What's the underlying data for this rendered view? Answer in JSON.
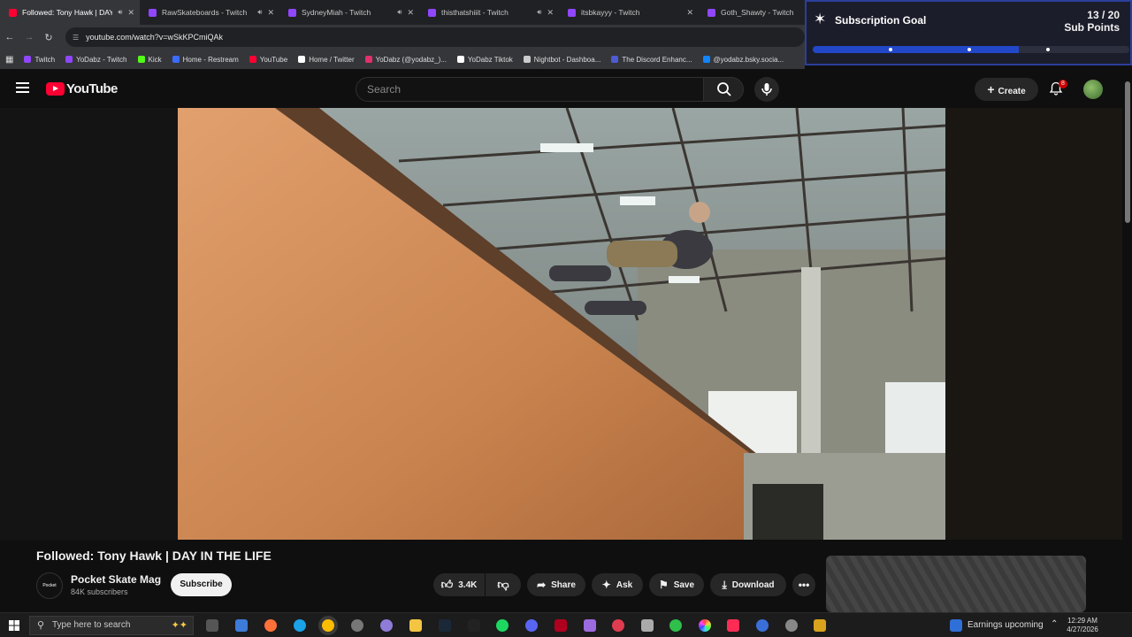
{
  "browser": {
    "tabs": [
      {
        "title": "Followed: Tony Hawk | DAY",
        "color": "#ff0033",
        "sound": true,
        "active": true
      },
      {
        "title": "RawSkateboards - Twitch",
        "color": "#9146ff",
        "sound": true
      },
      {
        "title": "SydneyMiah - Twitch",
        "color": "#9146ff",
        "sound": true
      },
      {
        "title": "thisthatshiiit - Twitch",
        "color": "#9146ff",
        "sound": true
      },
      {
        "title": "itsbkayyy - Twitch",
        "color": "#9146ff",
        "sound": false
      },
      {
        "title": "Goth_Shawty - Twitch",
        "color": "#9146ff",
        "sound": false
      }
    ],
    "url": "youtube.com/watch?v=wSkKPCmiQAk",
    "bookmarks": [
      {
        "label": "Twitch",
        "color": "#9146ff"
      },
      {
        "label": "YoDabz - Twitch",
        "color": "#9146ff"
      },
      {
        "label": "Kick",
        "color": "#53fc18"
      },
      {
        "label": "Home - Restream",
        "color": "#3b6cff"
      },
      {
        "label": "YouTube",
        "color": "#ff0033"
      },
      {
        "label": "Home / Twitter",
        "color": "#ffffff"
      },
      {
        "label": "YoDabz (@yodabz_)...",
        "color": "#e1306c"
      },
      {
        "label": "YoDabz Tiktok",
        "color": "#ffffff"
      },
      {
        "label": "Nightbot - Dashboa...",
        "color": "#cccccc"
      },
      {
        "label": "The Discord Enhanc...",
        "color": "#4e5bd6"
      },
      {
        "label": "@yodabz.bsky.socia...",
        "color": "#1185fe"
      }
    ]
  },
  "overlay": {
    "title": "Subscription Goal",
    "count": "13 / 20",
    "unit": "Sub Points",
    "progress": 0.65,
    "accent": "#2247c9"
  },
  "youtube": {
    "logo": "YouTube",
    "search_placeholder": "Search",
    "create": "Create",
    "notifications": "8",
    "video_title": "Followed: Tony Hawk | DAY IN THE LIFE",
    "channel": "Pocket Skate Mag",
    "channel_avatar": "Pocket",
    "subscribers": "84K subscribers",
    "subscribe": "Subscribe",
    "likes": "3.4K",
    "share": "Share",
    "ask": "Ask",
    "save": "Save",
    "download": "Download"
  },
  "taskbar": {
    "search_placeholder": "Type here to search",
    "earnings": "Earnings upcoming",
    "time": "12:29 AM",
    "date": "4/27/2026"
  }
}
